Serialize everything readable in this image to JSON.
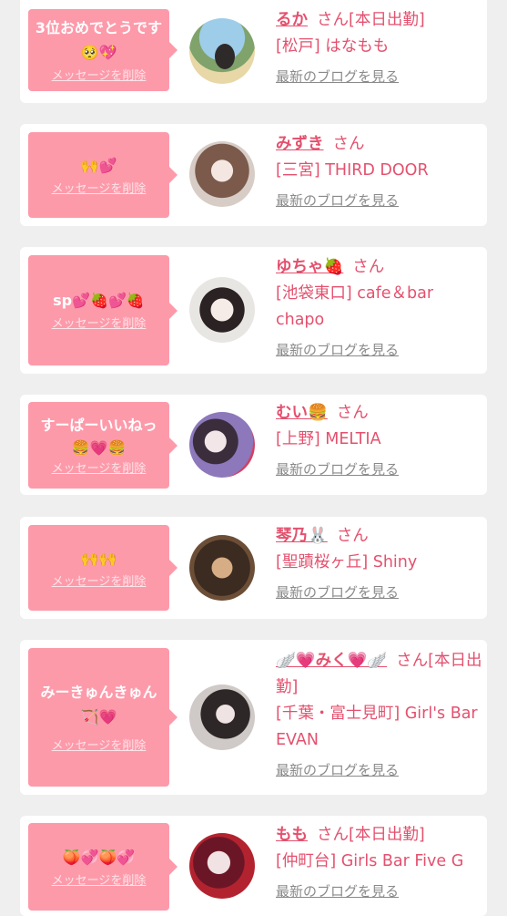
{
  "cards": [
    {
      "message": "3位おめでとうです🥺💖",
      "delete_label": "メッセージを削除",
      "name": "るか",
      "san": "さん[本日出勤]",
      "shop": "[松戸] はなもも",
      "blog_link": "最新のブログを見る",
      "avatar_desc": "photo",
      "avatar_colors": [
        "#8ec3e6",
        "#d9c89a"
      ]
    },
    {
      "message": "🙌💕",
      "delete_label": "メッセージを削除",
      "name": "みずき",
      "san": "さん",
      "shop": "[三宮] THIRD DOOR",
      "blog_link": "最新のブログを見る",
      "avatar_desc": "photo",
      "avatar_colors": [
        "#c9b5a6",
        "#6f5246"
      ]
    },
    {
      "message": "sp💕🍓💕🍓",
      "delete_label": "メッセージを削除",
      "name": "ゆちゃ🍓",
      "san": "さん",
      "shop": "[池袋東口] cafe＆bar chapo",
      "blog_link": "最新のブログを見る",
      "avatar_desc": "photo",
      "avatar_colors": [
        "#e5e3df",
        "#2a2222"
      ]
    },
    {
      "message": "すーぱーいいねっ🍔💗🍔",
      "delete_label": "メッセージを削除",
      "name": "むい🍔",
      "san": "さん",
      "shop": "[上野] MELTIA",
      "blog_link": "最新のブログを見る",
      "avatar_desc": "photo",
      "avatar_colors": [
        "#8a77b9",
        "#e3476a"
      ]
    },
    {
      "message": "🙌🙌",
      "delete_label": "メッセージを削除",
      "name": "琴乃🐰",
      "san": "さん",
      "shop": "[聖蹟桜ヶ丘] Shiny",
      "blog_link": "最新のブログを見る",
      "avatar_desc": "photo",
      "avatar_colors": [
        "#3b2b20",
        "#c99a6e"
      ]
    },
    {
      "message": "みーきゅんきゅん🏹💗",
      "delete_label": "メッセージを削除",
      "name": "🪽💗みく💗🪽",
      "san": "さん[本日出勤]",
      "shop": "[千葉・富士見町] Girl's Bar EVAN",
      "blog_link": "最新のブログを見る",
      "avatar_desc": "photo",
      "avatar_colors": [
        "#d6d0cf",
        "#332b2c"
      ]
    },
    {
      "message": "🍑💞🍑💞",
      "delete_label": "メッセージを削除",
      "name": "もも",
      "san": "さん[本日出勤]",
      "shop": "[仲町台] Girls Bar Five G",
      "blog_link": "最新のブログを見る",
      "avatar_desc": "photo",
      "avatar_colors": [
        "#a3192c",
        "#f0dfe2"
      ]
    }
  ]
}
